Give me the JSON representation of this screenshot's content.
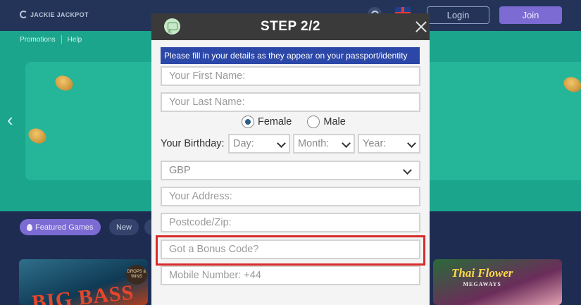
{
  "site": {
    "logo_text": "JACKIE JACKPOT",
    "login_label": "Login",
    "join_label": "Join",
    "subnav": [
      "Promotions",
      "Help"
    ],
    "chips": {
      "featured": "Featured Games",
      "new": "New"
    },
    "tiles": {
      "big_bass": "BIG BASS",
      "badge": "DROPS & WINS",
      "thai_flower": "Thai Flower",
      "thai_flower_sub": "MEGAWAYS"
    }
  },
  "modal": {
    "title": "STEP 2/2",
    "info": "Please fill in your details as they appear on your passport/identity",
    "first_name_placeholder": "Your First Name:",
    "last_name_placeholder": "Your Last Name:",
    "gender": {
      "female": "Female",
      "male": "Male",
      "selected": "female"
    },
    "birthday_label": "Your Birthday:",
    "day": "Day:",
    "month": "Month:",
    "year": "Year:",
    "currency": "GBP",
    "address_placeholder": "Your Address:",
    "postcode_placeholder": "Postcode/Zip:",
    "bonus_placeholder": "Got a Bonus Code?",
    "mobile_placeholder": "Mobile Number: +44"
  },
  "colors": {
    "modal_header": "#3a3a3a",
    "info_bar": "#2b47a8",
    "highlight": "#d92b2b",
    "hero": "#1aa58c",
    "join": "#7b6bd3"
  }
}
